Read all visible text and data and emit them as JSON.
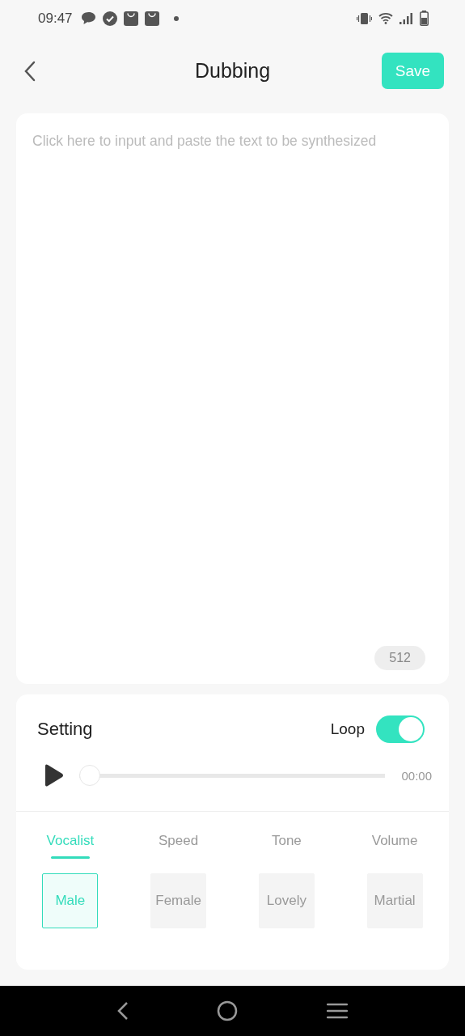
{
  "status_bar": {
    "time": "09:47"
  },
  "header": {
    "title": "Dubbing",
    "save": "Save"
  },
  "editor": {
    "placeholder": "Click here to input and paste the text to be synthesized",
    "counter": "512"
  },
  "setting": {
    "title": "Setting",
    "loop": {
      "label": "Loop",
      "on": true
    },
    "player": {
      "level": 0,
      "time": "00:00"
    },
    "tabs": [
      {
        "label": "Vocalist",
        "selected": true
      },
      {
        "label": "Speed",
        "selected": false
      },
      {
        "label": "Tone",
        "selected": false
      },
      {
        "label": "Volume",
        "selected": false
      }
    ],
    "options": [
      {
        "label": "Male",
        "selected": true
      },
      {
        "label": "Female",
        "selected": false
      },
      {
        "label": "Lovely",
        "selected": false
      },
      {
        "label": "Martial",
        "selected": false
      }
    ]
  }
}
